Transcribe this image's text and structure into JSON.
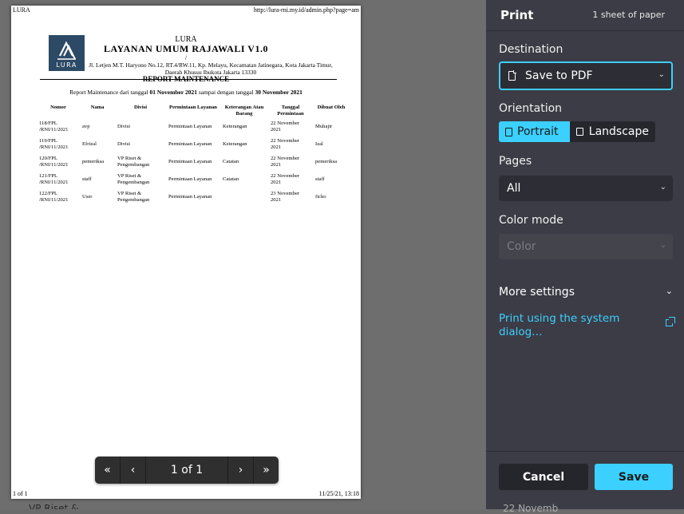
{
  "preview": {
    "header_left": "LURA",
    "header_right": "http://lura-rni.my.id/admin.php?page=am",
    "footer_left": "1 of 1",
    "footer_right": "11/25/21, 13:18",
    "logo_text": "LURA",
    "letterhead": {
      "line1": "LURA",
      "title": "LAYANAN UMUM RAJAWALI V1.0",
      "slash": "/",
      "address": "Jl. Letjen M.T. Haryono No.12, RT.4/RW.11, Kp. Melayu, Kecamatan Jatinegara, Kota Jakarta Timur, Daerah Khusus Ibukota Jakarta 13330"
    },
    "report_title": "REPORT MAINTENANCE",
    "range": {
      "prefix": "Report Maintenance dari tanggal ",
      "from": "01 November 2021",
      "mid": " sampai dengan tanggal ",
      "to": "30 November 2021"
    },
    "table": {
      "headers": [
        "Nomor",
        "Nama",
        "Divisi",
        "Permintaan Layanan",
        "Keterangan Atau Barang",
        "Tanggal Permintaan",
        "Dibuat Oleh"
      ],
      "rows": [
        [
          "118/FPL /RNI/11/2021",
          "avp",
          "Divisi",
          "Permintaan Layanan",
          "Keterangan",
          "22 November 2021",
          "Muhajir"
        ],
        [
          "119/FPL /RNI/11/2021",
          "Efrizal",
          "Divisi",
          "Permintaan Layanan",
          "Keterangan",
          "22 November 2021",
          "Izal"
        ],
        [
          "120/FPL /RNI/11/2021",
          "pemeriksa",
          "VP Riset & Pengembangan",
          "Permintaan Layanan",
          "Catatan",
          "22 November 2021",
          "pemeriksa"
        ],
        [
          "121/FPL /RNI/11/2021",
          "staff",
          "VP Riset & Pengembangan",
          "Permintaan Layanan",
          "Catatan",
          "22 November 2021",
          "staff"
        ],
        [
          "122/FPL /RNI/11/2021",
          "User",
          "VP Riset & Pengembangan",
          "Permintaan Layanan",
          "",
          "23 November 2021",
          "ficko"
        ]
      ]
    },
    "nav": {
      "first": "«",
      "prev": "‹",
      "page": "1 of 1",
      "next": "›",
      "last": "»"
    },
    "peek_left": "VP Riset &",
    "peek_right": "22 Novemb"
  },
  "panel": {
    "title": "Print",
    "sheets": "1 sheet of paper",
    "destination_label": "Destination",
    "destination_value": "Save to PDF",
    "orientation_label": "Orientation",
    "portrait": "Portrait",
    "landscape": "Landscape",
    "pages_label": "Pages",
    "pages_value": "All",
    "color_label": "Color mode",
    "color_value": "Color",
    "more_settings": "More settings",
    "system_dialog": "Print using the system dialog…",
    "cancel": "Cancel",
    "save": "Save",
    "accent": "#3bd0ff"
  }
}
